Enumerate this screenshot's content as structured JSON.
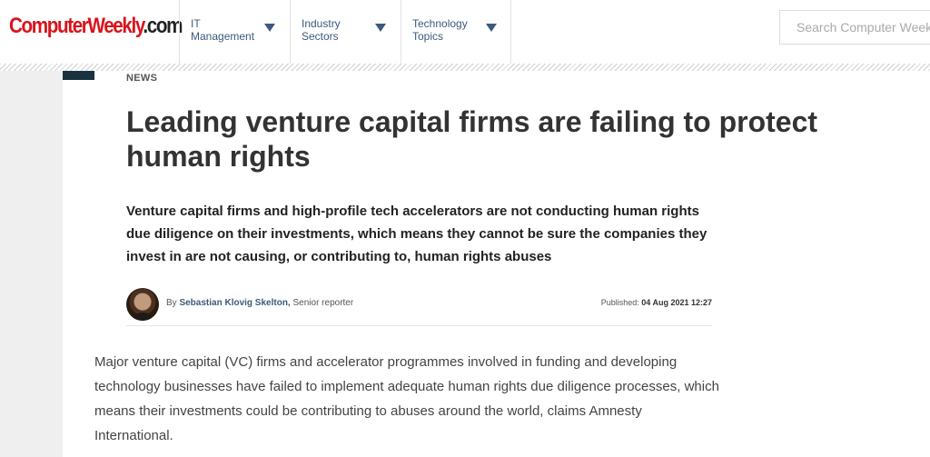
{
  "header": {
    "logo_main": "ComputerWeekly",
    "logo_suffix": ".com",
    "nav": [
      {
        "line1": "IT",
        "line2": "Management"
      },
      {
        "line1": "Industry",
        "line2": "Sectors"
      },
      {
        "line1": "Technology",
        "line2": "Topics"
      }
    ],
    "search_placeholder": "Search Computer Weekly"
  },
  "article": {
    "category": "NEWS",
    "headline": "Leading venture capital firms are failing to protect human rights",
    "summary": "Venture capital firms and high-profile tech accelerators are not conducting human rights due diligence on their investments, which means they cannot be sure the companies they invest in are not causing, or contributing to, human rights abuses",
    "byline_prefix": "By",
    "author": "Sebastian Klovig Skelton,",
    "author_role": "Senior reporter",
    "published_label": "Published:",
    "published_date": "04 Aug 2021 12:27",
    "body": "Major venture capital (VC) firms and accelerator programmes involved in funding and developing technology businesses have failed to implement adequate human rights due diligence processes, which means their investments could be contributing to abuses around the world, claims Amnesty International."
  }
}
